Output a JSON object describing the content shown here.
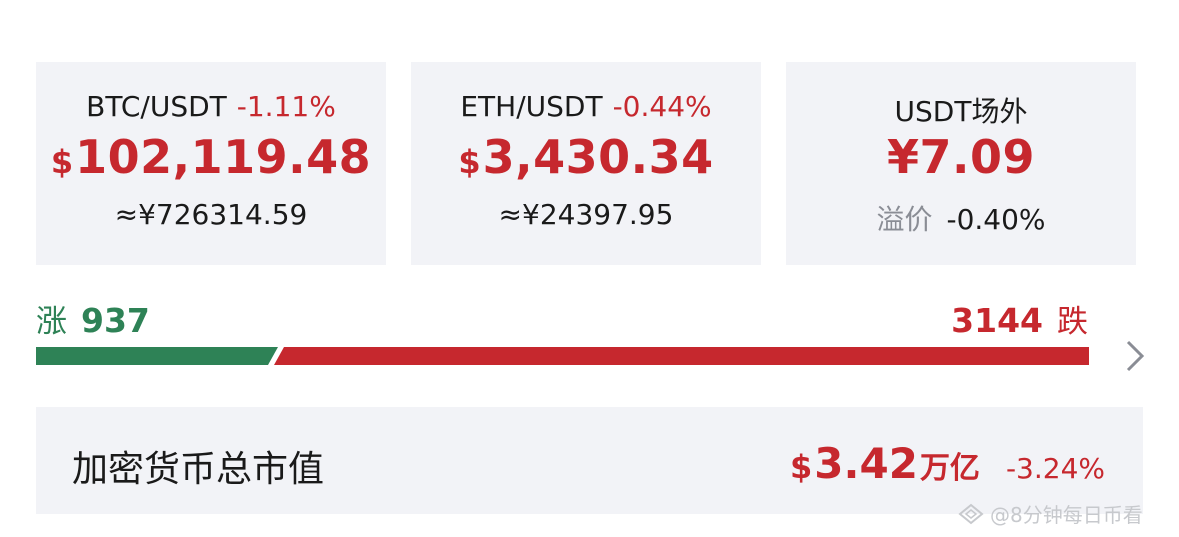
{
  "tickers": [
    {
      "pair": "BTC/USDT",
      "change": "-1.11%",
      "currency": "$",
      "price": "102,119.48",
      "cny": "≈¥726314.59"
    },
    {
      "pair": "ETH/USDT",
      "change": "-0.44%",
      "currency": "$",
      "price": "3,430.34",
      "cny": "≈¥24397.95"
    }
  ],
  "otc": {
    "title": "USDT场外",
    "price": "¥7.09",
    "premium_label": "溢价",
    "premium_value": "-0.40%"
  },
  "breadth": {
    "up_label": "涨",
    "up_count": "937",
    "down_count": "3144",
    "down_label": "跌",
    "up_ratio": 0.2296
  },
  "market_cap": {
    "label": "加密货币总市值",
    "currency": "$",
    "value": "3.42",
    "unit": "万亿",
    "change": "-3.24%"
  },
  "watermark": "@8分钟每日币看",
  "colors": {
    "up": "#2e8256",
    "down": "#c6282e",
    "card_bg": "#f2f3f7"
  },
  "icons": {
    "more": "chevron-right-icon",
    "watermark": "diamond-logo-icon"
  }
}
